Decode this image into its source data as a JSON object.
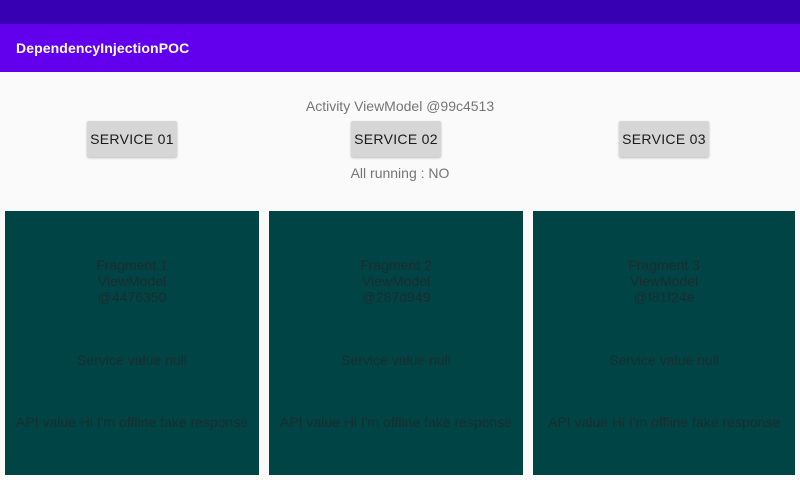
{
  "app_bar": {
    "title": "DependencyInjectionPOC"
  },
  "activity": {
    "viewmodel_text": "Activity ViewModel @99c4513",
    "all_running_text": "All running : NO"
  },
  "buttons": [
    {
      "label": "SERVICE 01"
    },
    {
      "label": "SERVICE 02"
    },
    {
      "label": "SERVICE 03"
    }
  ],
  "fragments": [
    {
      "line1": "Fragment 1",
      "line2": "ViewModel",
      "line3": "@4476350",
      "service_text": "Service value null",
      "api_text": "API value Hi I'm offline fake response"
    },
    {
      "line1": "Fragment 2",
      "line2": "ViewModel",
      "line3": "@287d949",
      "service_text": "Service value null",
      "api_text": "API value Hi I'm offline fake response"
    },
    {
      "line1": "Fragment 3",
      "line2": "ViewModel",
      "line3": "@f81f24e",
      "service_text": "Service value null",
      "api_text": "API value Hi I'm offline fake response"
    }
  ],
  "colors": {
    "status_bar": "#3700b3",
    "app_bar": "#6200ee",
    "fragment_background": "#004445",
    "button_background": "#d6d6d6"
  }
}
